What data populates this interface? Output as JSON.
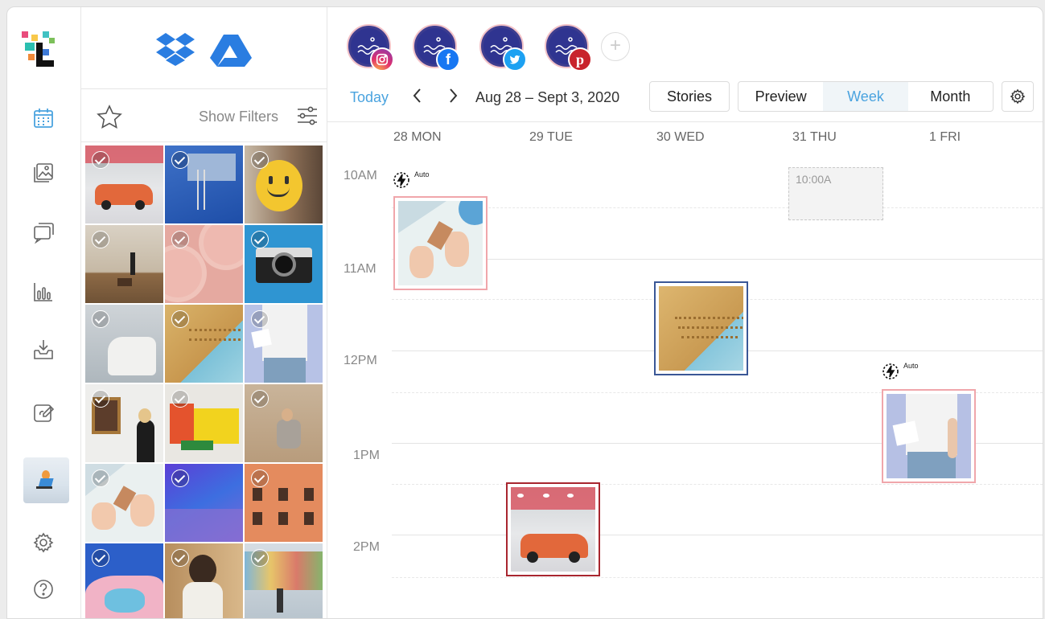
{
  "library": {
    "show_filters_label": "Show Filters",
    "sources": [
      "dropbox-icon",
      "google-drive-icon"
    ]
  },
  "rail": {
    "items": [
      "calendar-icon",
      "gallery-icon",
      "comments-icon",
      "analytics-icon",
      "inbox-download-icon",
      "edit-link-icon",
      "settings-icon",
      "help-icon"
    ]
  },
  "profiles": [
    {
      "network": "instagram",
      "color": "#d6249f"
    },
    {
      "network": "facebook",
      "color": "#1877f2"
    },
    {
      "network": "twitter",
      "color": "#1da1f2"
    },
    {
      "network": "pinterest",
      "color": "#c8232c"
    }
  ],
  "add_profile_label": "+",
  "toolbar": {
    "today_label": "Today",
    "prev_label": "‹",
    "next_label": "›",
    "date_range": "Aug 28 – Sept 3, 2020",
    "stories_label": "Stories",
    "view_options": [
      "Preview",
      "Week",
      "Month"
    ],
    "active_view": "Week"
  },
  "calendar": {
    "days": [
      "28 MON",
      "29 TUE",
      "30 WED",
      "31 THU",
      "1 FRI"
    ],
    "times": [
      "10AM",
      "11AM",
      "12PM",
      "1PM",
      "2PM"
    ],
    "auto_label": "Auto",
    "empty_slot_label": "10:00A"
  },
  "colors": {
    "accent": "#4aa3df",
    "instagram_frame": "#f0a6ab",
    "facebook_frame": "#3a5796",
    "pinterest_frame": "#a8262f"
  }
}
